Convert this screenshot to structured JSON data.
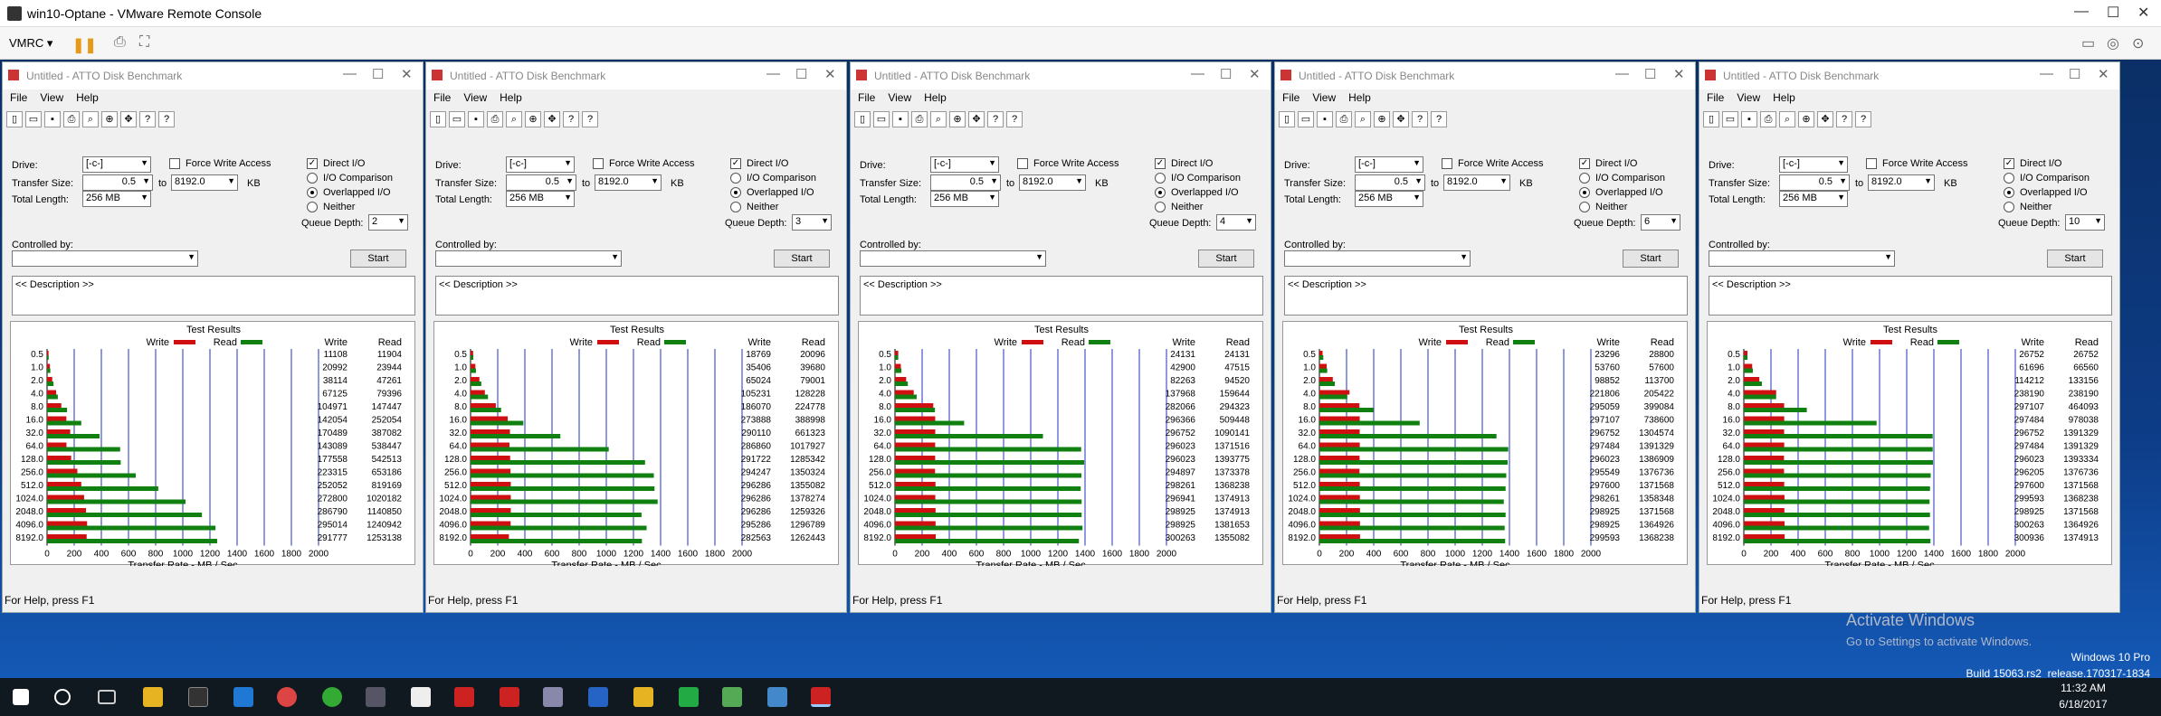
{
  "vm": {
    "title": "win10-Optane - VMware Remote Console",
    "vmrc_label": "VMRC ▾"
  },
  "atto": {
    "title": "Untitled - ATTO Disk Benchmark",
    "menu": [
      "File",
      "View",
      "Help"
    ],
    "drive_label": "Drive:",
    "drive_value": "[-c-]",
    "force_write": "Force Write Access",
    "direct_io": "Direct I/O",
    "transfer_label": "Transfer Size:",
    "transfer_from": "0.5",
    "to": "to",
    "transfer_to": "8192.0",
    "kb": "KB",
    "length_label": "Total Length:",
    "length_value": "256 MB",
    "io_comparison": "I/O Comparison",
    "overlapped": "Overlapped I/O",
    "neither": "Neither",
    "queue_label": "Queue Depth:",
    "controlled_by": "Controlled by:",
    "start": "Start",
    "description": "<< Description >>",
    "test_results": "Test Results",
    "write": "Write",
    "read": "Read",
    "x_axis_title": "Transfer Rate - MB / Sec",
    "status": "For Help, press F1"
  },
  "chart_data": [
    {
      "type": "bar",
      "queue_depth": "2",
      "categories": [
        "0.5",
        "1.0",
        "2.0",
        "4.0",
        "8.0",
        "16.0",
        "32.0",
        "64.0",
        "128.0",
        "256.0",
        "512.0",
        "1024.0",
        "2048.0",
        "4096.0",
        "8192.0"
      ],
      "xlim": [
        0,
        2000
      ],
      "x_ticks": [
        "0",
        "200",
        "400",
        "600",
        "800",
        "1000",
        "1200",
        "1400",
        "1600",
        "1800",
        "2000"
      ],
      "series": [
        {
          "name": "Write",
          "color": "#d01010",
          "values": [
            11108,
            20992,
            38114,
            67125,
            104971,
            142054,
            170489,
            143089,
            177558,
            223315,
            252052,
            272800,
            286790,
            295014,
            291777
          ]
        },
        {
          "name": "Read",
          "color": "#108010",
          "values": [
            11904,
            23944,
            47261,
            79396,
            147447,
            252054,
            387082,
            538447,
            542513,
            653186,
            819169,
            1020182,
            1140850,
            1240942,
            1253138
          ]
        }
      ]
    },
    {
      "type": "bar",
      "queue_depth": "3",
      "categories": [
        "0.5",
        "1.0",
        "2.0",
        "4.0",
        "8.0",
        "16.0",
        "32.0",
        "64.0",
        "128.0",
        "256.0",
        "512.0",
        "1024.0",
        "2048.0",
        "4096.0",
        "8192.0"
      ],
      "xlim": [
        0,
        2000
      ],
      "x_ticks": [
        "0",
        "200",
        "400",
        "600",
        "800",
        "1000",
        "1200",
        "1400",
        "1600",
        "1800",
        "2000"
      ],
      "series": [
        {
          "name": "Write",
          "color": "#d01010",
          "values": [
            18769,
            35406,
            65024,
            105231,
            186070,
            273888,
            290110,
            286860,
            291722,
            294247,
            296286,
            296286,
            296286,
            295286,
            282563
          ]
        },
        {
          "name": "Read",
          "color": "#108010",
          "values": [
            20096,
            39680,
            79001,
            128228,
            224778,
            388998,
            661323,
            1017927,
            1285342,
            1350324,
            1355082,
            1378274,
            1259326,
            1296789,
            1262443
          ]
        }
      ]
    },
    {
      "type": "bar",
      "queue_depth": "4",
      "categories": [
        "0.5",
        "1.0",
        "2.0",
        "4.0",
        "8.0",
        "16.0",
        "32.0",
        "64.0",
        "128.0",
        "256.0",
        "512.0",
        "1024.0",
        "2048.0",
        "4096.0",
        "8192.0"
      ],
      "xlim": [
        0,
        2000
      ],
      "x_ticks": [
        "0",
        "200",
        "400",
        "600",
        "800",
        "1000",
        "1200",
        "1400",
        "1600",
        "1800",
        "2000"
      ],
      "series": [
        {
          "name": "Write",
          "color": "#d01010",
          "values": [
            24131,
            42900,
            82263,
            137968,
            282066,
            296366,
            296752,
            296023,
            296023,
            294897,
            298261,
            296941,
            298925,
            298925,
            300263
          ]
        },
        {
          "name": "Read",
          "color": "#108010",
          "values": [
            24131,
            47515,
            94520,
            159644,
            294323,
            509448,
            1090141,
            1371516,
            1393775,
            1373378,
            1368238,
            1374913,
            1374913,
            1381653,
            1355082
          ]
        }
      ]
    },
    {
      "type": "bar",
      "queue_depth": "6",
      "categories": [
        "0.5",
        "1.0",
        "2.0",
        "4.0",
        "8.0",
        "16.0",
        "32.0",
        "64.0",
        "128.0",
        "256.0",
        "512.0",
        "1024.0",
        "2048.0",
        "4096.0",
        "8192.0"
      ],
      "xlim": [
        0,
        2000
      ],
      "x_ticks": [
        "0",
        "200",
        "400",
        "600",
        "800",
        "1000",
        "1200",
        "1400",
        "1600",
        "1800",
        "2000"
      ],
      "series": [
        {
          "name": "Write",
          "color": "#d01010",
          "values": [
            23296,
            53760,
            98852,
            221806,
            295059,
            297107,
            296752,
            297484,
            296023,
            295549,
            297600,
            298261,
            298925,
            298925,
            299593
          ]
        },
        {
          "name": "Read",
          "color": "#108010",
          "values": [
            28800,
            57600,
            113700,
            205422,
            399084,
            738600,
            1304574,
            1391329,
            1386909,
            1376736,
            1371568,
            1358348,
            1371568,
            1364926,
            1368238
          ]
        }
      ]
    },
    {
      "type": "bar",
      "queue_depth": "10",
      "categories": [
        "0.5",
        "1.0",
        "2.0",
        "4.0",
        "8.0",
        "16.0",
        "32.0",
        "64.0",
        "128.0",
        "256.0",
        "512.0",
        "1024.0",
        "2048.0",
        "4096.0",
        "8192.0"
      ],
      "xlim": [
        0,
        2000
      ],
      "x_ticks": [
        "0",
        "200",
        "400",
        "600",
        "800",
        "1000",
        "1200",
        "1400",
        "1600",
        "1800",
        "2000"
      ],
      "series": [
        {
          "name": "Write",
          "color": "#d01010",
          "values": [
            26752,
            61696,
            114212,
            238190,
            297107,
            297484,
            296752,
            297484,
            296023,
            296205,
            297600,
            299593,
            298925,
            300263,
            300936
          ]
        },
        {
          "name": "Read",
          "color": "#108010",
          "values": [
            26752,
            66560,
            133156,
            238190,
            464093,
            978038,
            1391329,
            1391329,
            1393334,
            1376736,
            1371568,
            1368238,
            1371568,
            1364926,
            1374913
          ]
        }
      ]
    }
  ],
  "watermark": {
    "line1": "Activate Windows",
    "line2": "Go to Settings to activate Windows."
  },
  "os": {
    "edition": "Windows 10 Pro",
    "build": "Build 15063.rs2_release.170317-1834",
    "time": "11:32 AM",
    "date": "6/18/2017"
  }
}
